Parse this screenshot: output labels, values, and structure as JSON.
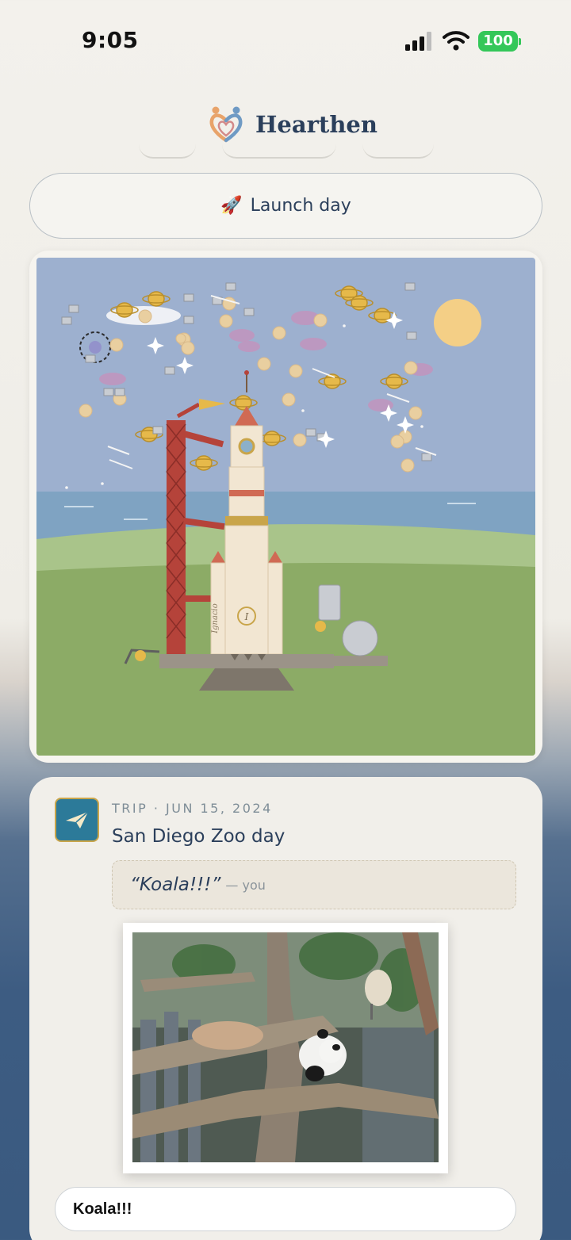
{
  "status": {
    "time": "9:05",
    "battery": "100"
  },
  "brand": {
    "name": "Hearthen"
  },
  "launch": {
    "emoji": "🚀",
    "label": "Launch day"
  },
  "scene": {
    "rocket_name": "Ignacio",
    "badge_letter": "I"
  },
  "memory": {
    "meta": "TRIP · JUN 15, 2024",
    "title": "San Diego Zoo day",
    "quote": "“Koala!!!”",
    "quote_author": "— you",
    "caption": "Koala!!!"
  },
  "colors": {
    "accent": "#2c7a99",
    "battery": "#34c759",
    "text": "#2b3f5b"
  }
}
